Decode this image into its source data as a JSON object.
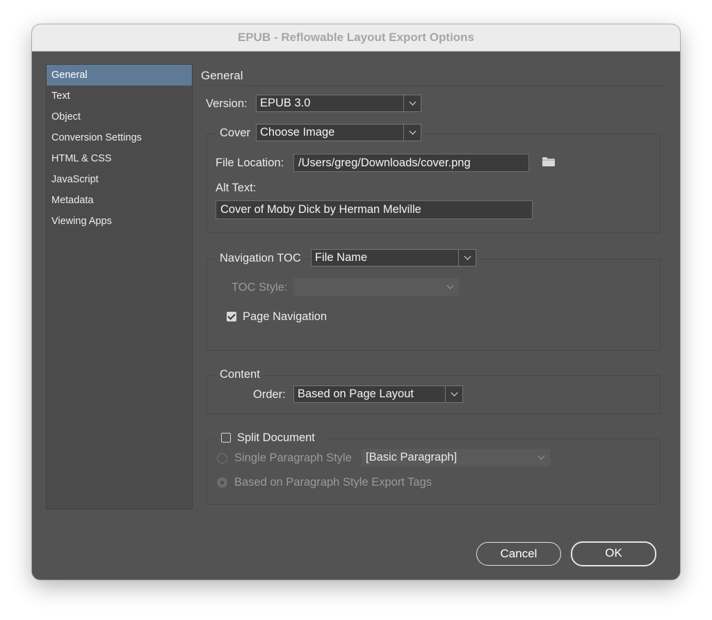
{
  "window": {
    "title": "EPUB - Reflowable Layout Export Options"
  },
  "sidebar": {
    "items": [
      {
        "label": "General",
        "selected": true
      },
      {
        "label": "Text"
      },
      {
        "label": "Object"
      },
      {
        "label": "Conversion Settings"
      },
      {
        "label": "HTML & CSS"
      },
      {
        "label": "JavaScript"
      },
      {
        "label": "Metadata"
      },
      {
        "label": "Viewing Apps"
      }
    ]
  },
  "panel": {
    "title": "General",
    "version": {
      "label": "Version:",
      "value": "EPUB 3.0"
    },
    "cover": {
      "label": "Cover",
      "value": "Choose Image",
      "file_location_label": "File Location:",
      "file_location_value": "/Users/greg/Downloads/cover.png",
      "folder_icon": "folder-icon",
      "alt_text_label": "Alt Text:",
      "alt_text_value": "Cover of Moby Dick by Herman Melville"
    },
    "navigation": {
      "label": "Navigation TOC",
      "value": "File Name",
      "toc_style_label": "TOC Style:",
      "toc_style_value": "",
      "page_navigation_label": "Page Navigation",
      "page_navigation_checked": true
    },
    "content": {
      "label": "Content",
      "order_label": "Order:",
      "order_value": "Based on Page Layout"
    },
    "split": {
      "label": "Split Document",
      "checked": false,
      "single_paragraph_style_label": "Single Paragraph Style",
      "single_paragraph_style_value": "[Basic Paragraph]",
      "export_tags_label": "Based on Paragraph Style Export Tags"
    }
  },
  "buttons": {
    "cancel": "Cancel",
    "ok": "OK"
  },
  "colors": {
    "dialog_bg": "#535353",
    "sidebar_selected": "#5e7a96",
    "field_bg": "#3b3b3b",
    "titlebar_bg": "#ececec"
  }
}
